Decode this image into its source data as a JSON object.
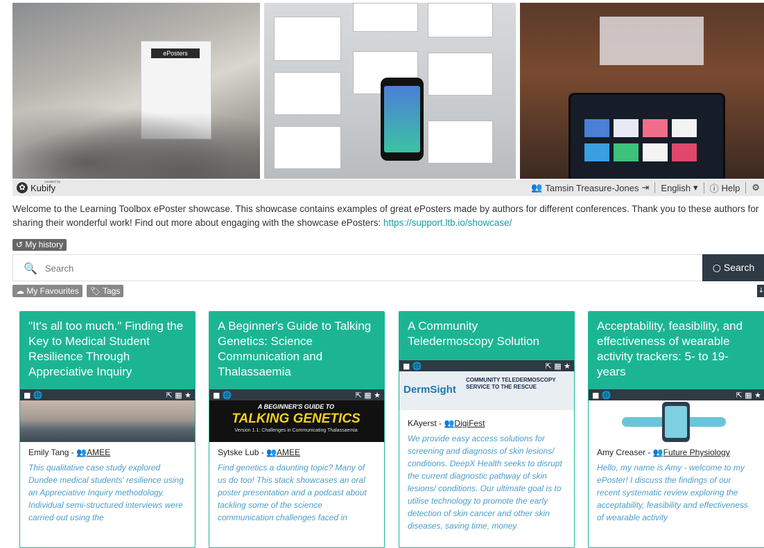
{
  "brand": {
    "label": "Kubify",
    "tag": "created by"
  },
  "user": {
    "name": "Tamsin Treasure-Jones",
    "language": "English",
    "help": "Help"
  },
  "banner": {
    "booth_sign": "ePosters"
  },
  "welcome": {
    "text": "Welcome to the Learning Toolbox ePoster showcase. This showcase contains examples of great ePosters made by authors for different conferences. Thank you to these authors for sharing their wonderful work! Find out more about engaging with the showcase ePosters: ",
    "link": "https://support.ltb.io/showcase/"
  },
  "history": {
    "label": "My history"
  },
  "search": {
    "placeholder": "Search",
    "button": "Search"
  },
  "filters": {
    "favourites": "My Favourites",
    "tags": "Tags"
  },
  "cards": [
    {
      "title": "\"It's all too much.\" Finding the Key to Medical Student Resilience Through Appreciative Inquiry",
      "author": "Emily Tang - ",
      "org": "AMEE",
      "desc": "This qualitative case study explored Dundee medical students' resilience using an Appreciative Inquiry methodology. Individual semi-structured interviews were carried out using the"
    },
    {
      "title": "A Beginner's Guide to Talking Genetics: Science Communication and Thalassaemia",
      "image_title": "A BEGINNER'S GUIDE TO",
      "image_main": "TALKING GENETICS",
      "image_sub": "Version 1.1: Challenges in Communicating Thalassaemia",
      "author": "Sytske Lub - ",
      "org": "AMEE",
      "desc": "Find genetics a daunting topic? Many of us do too! This stack showcases an oral poster presentation and a podcast about tackling some of the science communication challenges faced in"
    },
    {
      "title": "A Community Teledermoscopy Solution",
      "image_brand": "DermSight",
      "image_title": "COMMUNITY TELEDERMOSCOPY SERVICE TO THE RESCUE",
      "author": "KAyerst - ",
      "org": "DigiFest",
      "desc": "We provide easy access solutions for screening and diagnosis of skin lesions/ conditions. DeepX Health seeks to disrupt the current diagnostic pathway of skin lesions/ conditions. Our ultimate goal is to utilise technology to promote the early detection of skin cancer and other skin diseases, saving time, money"
    },
    {
      "title": "Acceptability, feasibility, and effectiveness of wearable activity trackers: 5- to 19-years",
      "author": "Amy Creaser - ",
      "org": "Future Physiology",
      "desc": "Hello, my name is Amy - welcome to my ePoster! I discuss the findings of our recent systematic review exploring the acceptability, feasibility and effectiveness of wearable activity"
    }
  ],
  "colors": {
    "accent": "#1cb594",
    "dark": "#2e3a44",
    "link": "#1a9aa0",
    "desc": "#4a9ec9"
  }
}
